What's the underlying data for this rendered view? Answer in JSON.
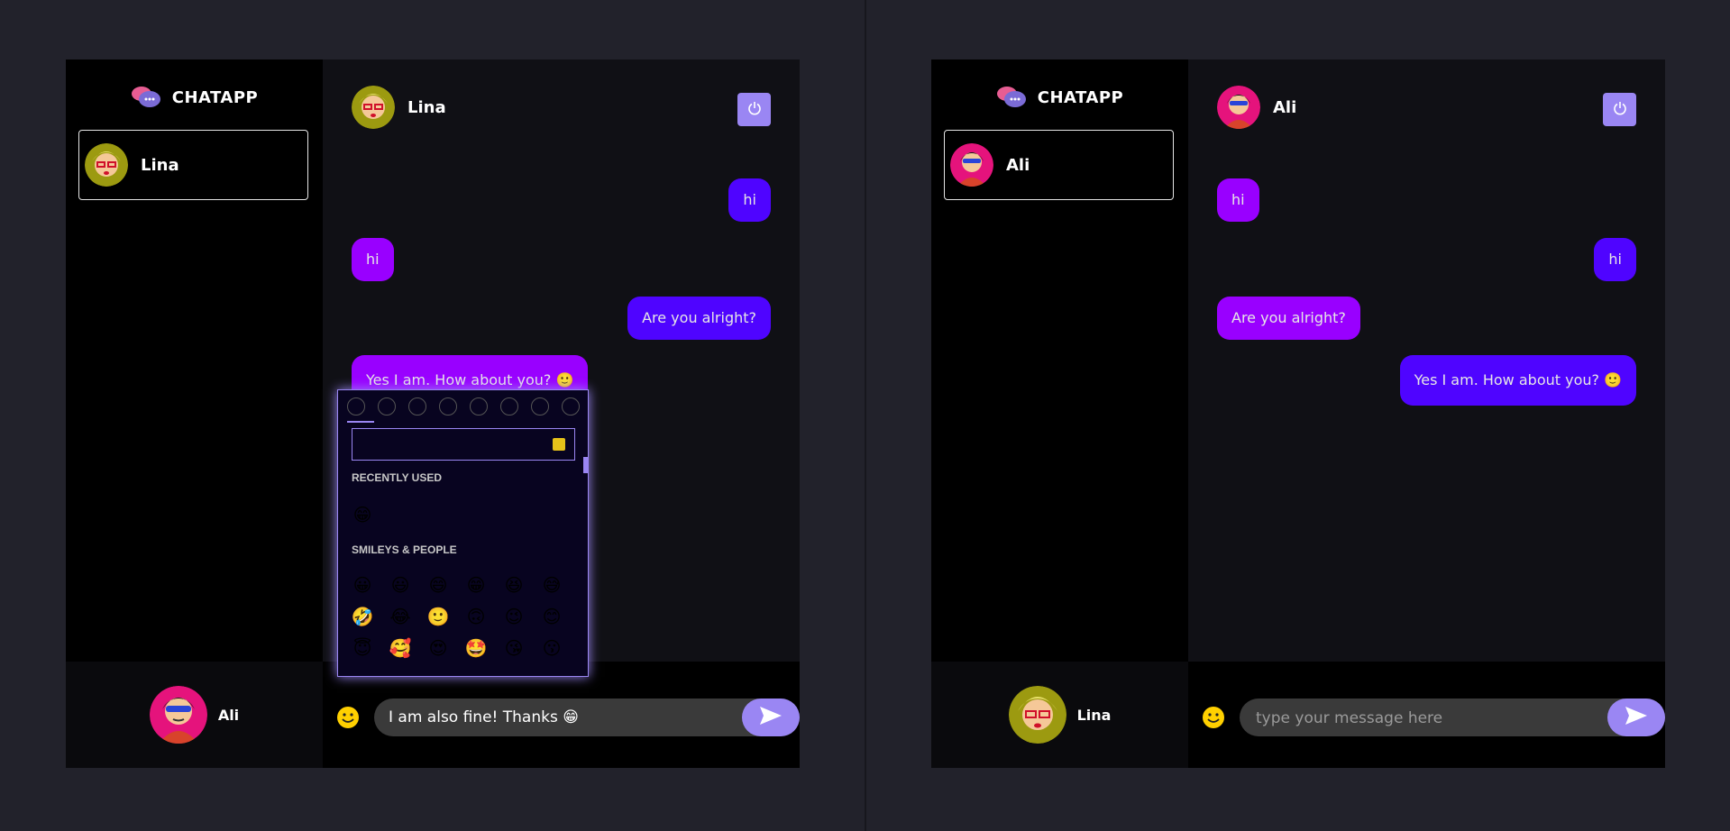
{
  "app": {
    "brand": "CHATAPP"
  },
  "left": {
    "contact_name": "Lina",
    "chat_name": "Lina",
    "current_user": "Ali",
    "messages": [
      {
        "text": "hi",
        "side": "sent"
      },
      {
        "text": "hi",
        "side": "recv"
      },
      {
        "text": "Are you alright?",
        "side": "sent"
      },
      {
        "text": "Yes I am. How about you? 🙂",
        "side": "recv"
      }
    ],
    "input_value": "I am also fine! Thanks 😁"
  },
  "right": {
    "contact_name": "Ali",
    "chat_name": "Ali",
    "current_user": "Lina",
    "messages": [
      {
        "text": "hi",
        "side": "recv"
      },
      {
        "text": "hi",
        "side": "sent"
      },
      {
        "text": "Are you alright?",
        "side": "recv"
      },
      {
        "text": "Yes I am. How about you? 🙂",
        "side": "sent"
      }
    ],
    "input_placeholder": "type your message here"
  },
  "emoji_picker": {
    "recent_title": "RECENTLY USED",
    "recent": [
      "😁"
    ],
    "smileys_title": "SMILEYS & PEOPLE",
    "smileys": [
      "😀",
      "😃",
      "😄",
      "😁",
      "😆",
      "😅",
      "🤣",
      "😂",
      "🙂",
      "🙃",
      "😉",
      "😊",
      "😇",
      "🥰",
      "😍",
      "🤩",
      "😘",
      "😗",
      "😚",
      "😙",
      "😋",
      "😛",
      "😜",
      "🤪"
    ]
  },
  "colors": {
    "sent_bubble": "#4f04ff",
    "recv_bubble": "#9900ff",
    "accent": "#9a86f3"
  }
}
